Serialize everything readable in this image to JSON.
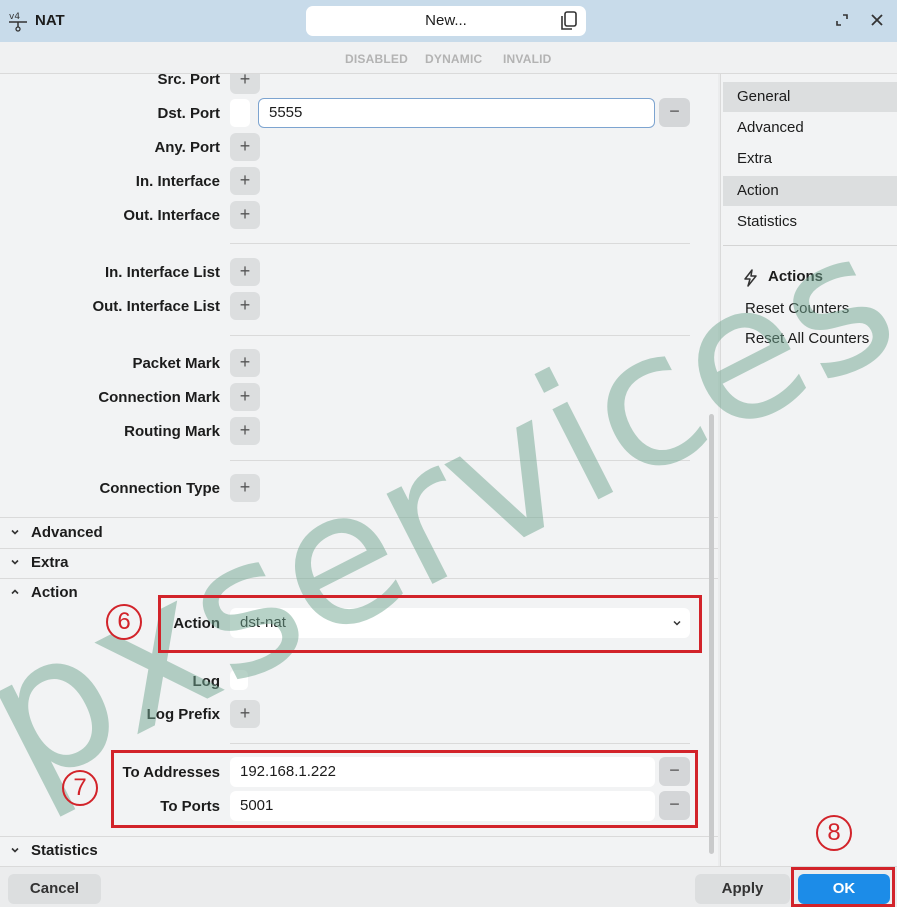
{
  "titlebar": {
    "app_title": "NAT",
    "window_title": "New..."
  },
  "status": {
    "disabled": "DISABLED",
    "dynamic": "DYNAMIC",
    "invalid": "INVALID"
  },
  "form": {
    "src_port": "Src. Port",
    "dst_port": "Dst. Port",
    "dst_port_value": "5555",
    "any_port": "Any. Port",
    "in_interface": "In. Interface",
    "out_interface": "Out. Interface",
    "in_interface_list": "In. Interface List",
    "out_interface_list": "Out. Interface List",
    "packet_mark": "Packet Mark",
    "connection_mark": "Connection Mark",
    "routing_mark": "Routing Mark",
    "connection_type": "Connection Type",
    "plus_glyph": "+",
    "minus_glyph": "−"
  },
  "sections": {
    "advanced": "Advanced",
    "extra": "Extra",
    "action": "Action",
    "statistics": "Statistics"
  },
  "action": {
    "action_label": "Action",
    "action_value": "dst-nat",
    "log_label": "Log",
    "log_prefix_label": "Log Prefix",
    "to_addresses_label": "To Addresses",
    "to_addresses_value": "192.168.1.222",
    "to_ports_label": "To Ports",
    "to_ports_value": "5001"
  },
  "sidebar": {
    "items": [
      {
        "label": "General",
        "selected": true
      },
      {
        "label": "Advanced",
        "selected": false
      },
      {
        "label": "Extra",
        "selected": false
      },
      {
        "label": "Action",
        "selected": true
      },
      {
        "label": "Statistics",
        "selected": false
      }
    ],
    "actions_title": "Actions",
    "actions": [
      "Reset Counters",
      "Reset All Counters"
    ]
  },
  "footer": {
    "cancel": "Cancel",
    "apply": "Apply",
    "ok": "OK"
  },
  "annotations": {
    "step6": "6",
    "step7": "7",
    "step8": "8"
  },
  "watermark": "pxservices.v",
  "colors": {
    "accent": "#1c8ce8",
    "annotation": "#d2232a",
    "titlebar": "#c8dbea",
    "watermark": "#6fa58f"
  }
}
